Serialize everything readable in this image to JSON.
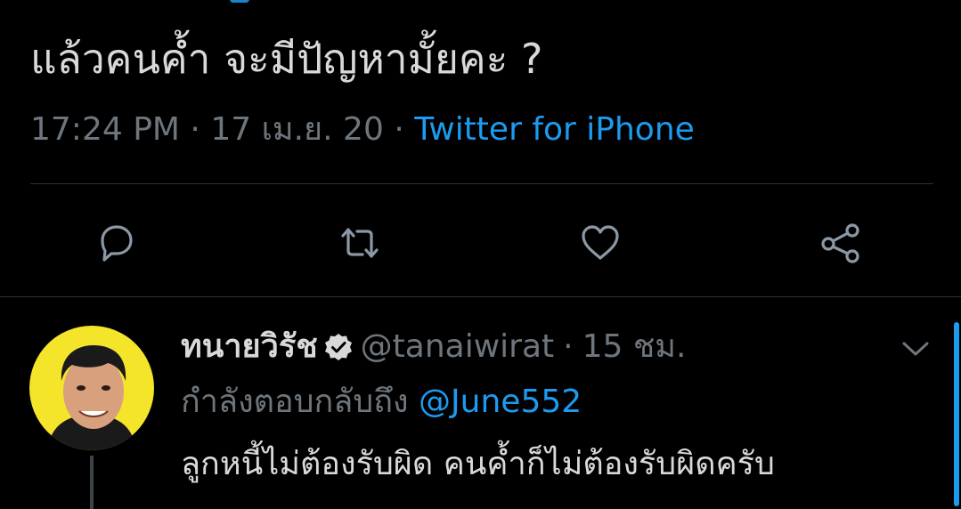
{
  "tweet": {
    "text": "แล้วคนค้ำ จะมีปัญหามั้ยคะ ?",
    "time": "17:24 PM",
    "date": "17 เม.ย. 20",
    "separator": "·",
    "source": "Twitter for iPhone"
  },
  "actions": {
    "reply_icon": "reply-bubble-icon",
    "retweet_icon": "retweet-icon",
    "like_icon": "heart-icon",
    "share_icon": "share-icon"
  },
  "reply": {
    "display_name": "ทนายวิรัช",
    "verified_icon": "verified-badge-icon",
    "handle": "@tanaiwirat",
    "separator": "·",
    "time_ago": "15 ชม.",
    "replying_to_label": "กำลังตอบกลับถึง",
    "replying_to_handle": "@June552",
    "text": "ลูกหนี้ไม่ต้องรับผิด คนค้ำก็ไม่ต้องรับผิดครับ"
  },
  "colors": {
    "background": "#000000",
    "text_primary": "#d9d9d9",
    "text_secondary": "#6e767d",
    "accent": "#1d9bf0",
    "divider": "#2f3336",
    "avatar_bg": "#f5e52a"
  }
}
